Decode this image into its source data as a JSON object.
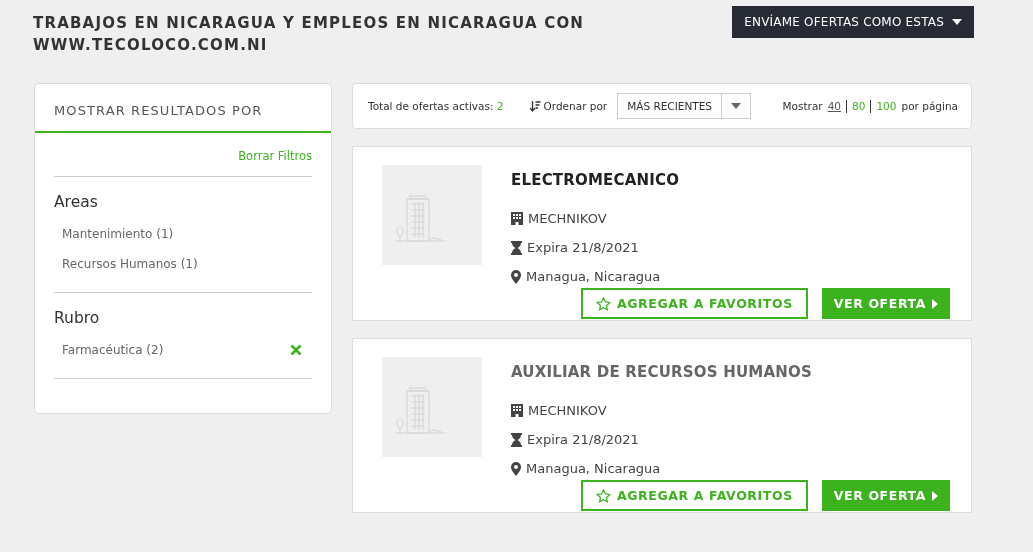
{
  "header": {
    "title": "TRABAJOS EN NICARAGUA Y EMPLEOS EN NICARAGUA CON WWW.TECOLOCO.COM.NI",
    "alert_button": "ENVÍAME OFERTAS COMO ESTAS"
  },
  "sidebar": {
    "title": "MOSTRAR RESULTADOS POR",
    "clear_link": "Borrar Filtros",
    "groups": [
      {
        "title": "Areas",
        "items": [
          {
            "label": "Mantenimiento (1)",
            "removable": false
          },
          {
            "label": "Recursos Humanos (1)",
            "removable": false
          }
        ]
      },
      {
        "title": "Rubro",
        "items": [
          {
            "label": "Farmacéutica (2)",
            "removable": true
          }
        ]
      }
    ]
  },
  "toolbar": {
    "total_label": "Total de ofertas activas:",
    "total": "2",
    "sort_label": "Ordenar por",
    "sort_value": "MÁS RECIENTES",
    "show_label": "Mostrar",
    "page_sizes": [
      {
        "label": "40",
        "selected": true
      },
      {
        "label": "80",
        "selected": false
      },
      {
        "label": "100",
        "selected": false
      }
    ],
    "per_page_label": "por página"
  },
  "jobs": [
    {
      "title": "ELECTROMECANICO",
      "highlighted": true,
      "company": "MECHNIKOV",
      "expires": "Expira 21/8/2021",
      "location": "Managua, Nicaragua",
      "favorite_button": "AGREGAR A FAVORITOS",
      "view_button": "VER OFERTA"
    },
    {
      "title": "AUXILIAR DE RECURSOS HUMANOS",
      "highlighted": false,
      "company": "MECHNIKOV",
      "expires": "Expira 21/8/2021",
      "location": "Managua, Nicaragua",
      "favorite_button": "AGREGAR A FAVORITOS",
      "view_button": "VER OFERTA"
    }
  ]
}
